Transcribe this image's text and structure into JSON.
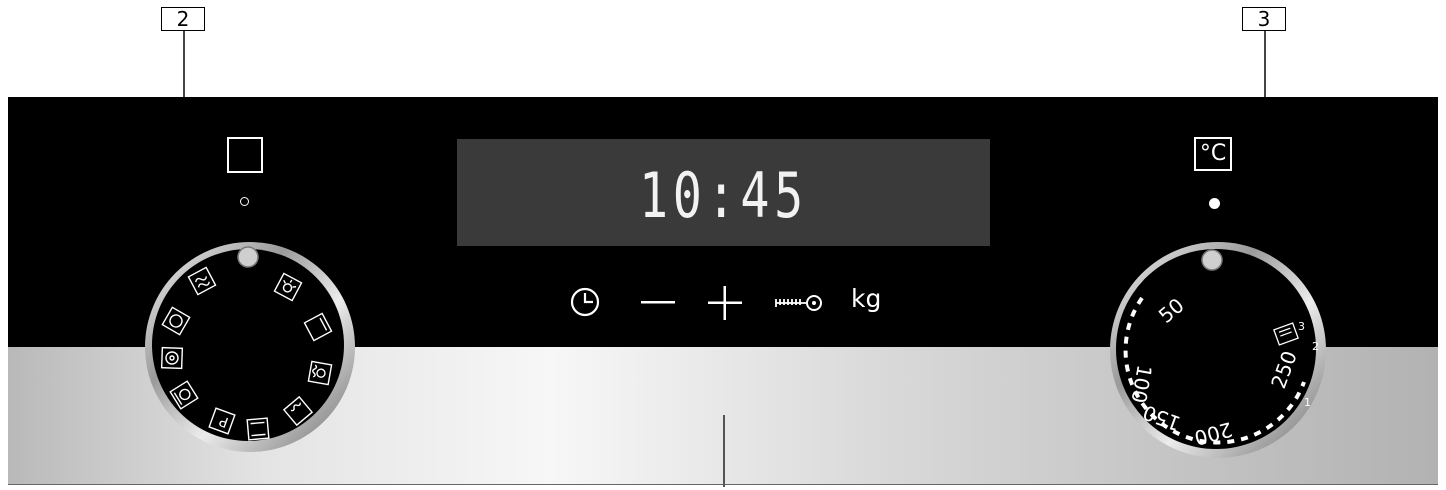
{
  "callouts": {
    "left": "2",
    "right": "3"
  },
  "display": {
    "time": "10:45"
  },
  "touch_controls": {
    "clock_icon": "clock-icon",
    "minus_icon": "minus-icon",
    "plus_icon": "plus-icon",
    "key_icon": "key-icon",
    "weight_label": "kg"
  },
  "function_selector": {
    "indicator_icon": "square-outline-icon",
    "led_state": "off",
    "mode_icons": [
      "grill-steam-icon",
      "lamp-icon",
      "top-heat-icon",
      "fan-bottom-heat-icon",
      "bottom-heat-icon",
      "top-bottom-heat-icon",
      "pizza-mode-icon",
      "fan-grill-icon",
      "fan-ring-heat-icon",
      "fan-icon"
    ],
    "mode_label_p": "P"
  },
  "temperature_selector": {
    "indicator_label": "°C",
    "led_state": "on",
    "scale": [
      "50",
      "100",
      "150",
      "200",
      "250"
    ],
    "grill_levels": [
      "1",
      "2",
      "3"
    ]
  },
  "colors": {
    "panel_black": "#000000",
    "display_bg": "#3a3a3a",
    "display_text": "#f2f2f2"
  }
}
